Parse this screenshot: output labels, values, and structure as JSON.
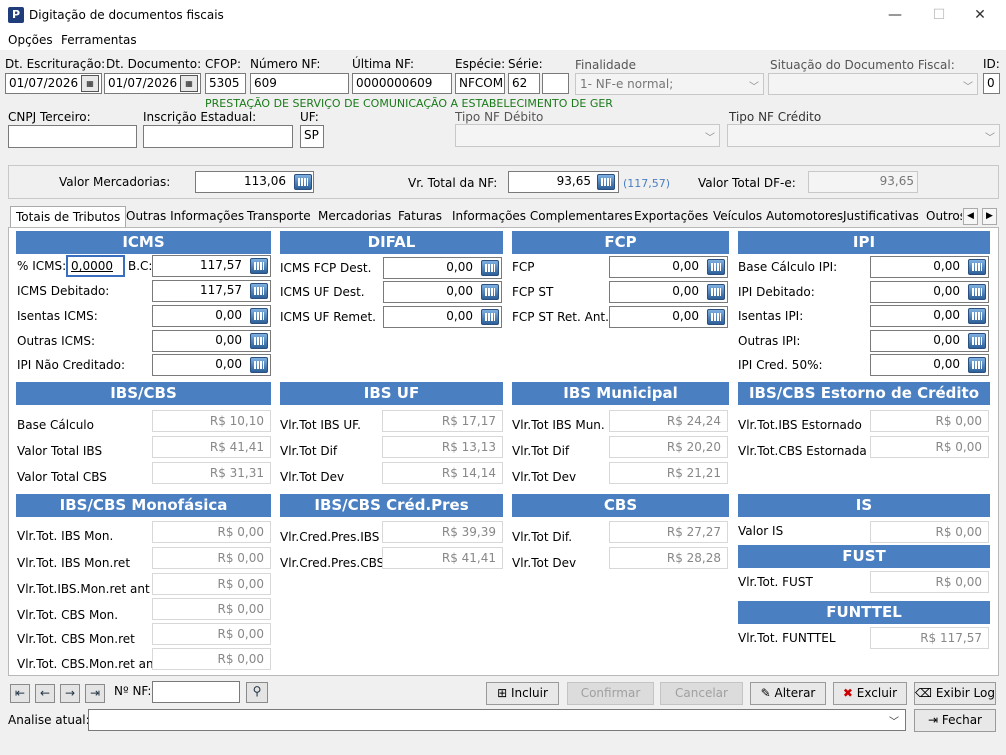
{
  "window": {
    "title": "Digitação de documentos fiscais",
    "minimize": "—",
    "maximize": "☐",
    "close": "✕"
  },
  "menu": [
    "Opções",
    "Ferramentas"
  ],
  "header": {
    "dt_escrituracao": {
      "label": "Dt. Escrituração:",
      "value": "01/07/2026"
    },
    "dt_documento": {
      "label": "Dt. Documento:",
      "value": "01/07/2026"
    },
    "cfop": {
      "label": "CFOP:",
      "value": "5305"
    },
    "numero_nf": {
      "label": "Número NF:",
      "value": "609"
    },
    "ultima_nf": {
      "label": "Última NF:",
      "value": "0000000609"
    },
    "especie": {
      "label": "Espécie:",
      "value": "NFCOM"
    },
    "serie": {
      "label": "Série:",
      "value": "62",
      "extra": ""
    },
    "finalidade": {
      "label": "Finalidade",
      "value": "1- NF-e normal;"
    },
    "situacao": {
      "label": "Situação do Documento Fiscal:",
      "value": ""
    },
    "id": {
      "label": "ID:",
      "value": "0"
    },
    "cfop_desc": "PRESTAÇÃO DE SERVIÇO DE COMUNICAÇÃO A ESTABELECIMENTO DE GER",
    "cnpj_terceiro": {
      "label": "CNPJ Terceiro:",
      "value": ""
    },
    "inscricao_estadual": {
      "label": "Inscrição Estadual:",
      "value": ""
    },
    "uf": {
      "label": "UF:",
      "value": "SP"
    },
    "tipo_nf_debito": {
      "label": "Tipo NF Débito",
      "value": ""
    },
    "tipo_nf_credito": {
      "label": "Tipo NF Crédito",
      "value": ""
    }
  },
  "totals": {
    "valor_mercadorias": {
      "label": "Valor Mercadorias:",
      "value": "113,06"
    },
    "vr_total_nf": {
      "label": "Vr. Total da NF:",
      "value": "93,65",
      "hint": "(117,57)"
    },
    "valor_total_dfe": {
      "label": "Valor Total DF-e:",
      "value": "93,65"
    }
  },
  "tabs": [
    "Totais de Tributos",
    "Outras Informações",
    "Transporte",
    "Mercadorias",
    "Faturas",
    "Informações Complementares",
    "Exportações",
    "Veículos Automotores",
    "Justificativas",
    "Outros"
  ],
  "sections": {
    "icms": {
      "title": "ICMS",
      "pct_label": "% ICMS:",
      "pct_value": "0,0000",
      "bc_label": "B.C:",
      "bc_value": "117,57",
      "rows": [
        {
          "label": "ICMS Debitado:",
          "value": "117,57"
        },
        {
          "label": "Isentas ICMS:",
          "value": "0,00"
        },
        {
          "label": "Outras ICMS:",
          "value": "0,00"
        },
        {
          "label": "IPI Não Creditado:",
          "value": "0,00"
        }
      ]
    },
    "difal": {
      "title": "DIFAL",
      "rows": [
        {
          "label": "ICMS FCP Dest.",
          "value": "0,00"
        },
        {
          "label": "ICMS UF Dest.",
          "value": "0,00"
        },
        {
          "label": "ICMS UF Remet.",
          "value": "0,00"
        }
      ]
    },
    "fcp": {
      "title": "FCP",
      "rows": [
        {
          "label": "FCP",
          "value": "0,00"
        },
        {
          "label": "FCP ST",
          "value": "0,00"
        },
        {
          "label": "FCP ST Ret. Ant.",
          "value": "0,00"
        }
      ]
    },
    "ipi": {
      "title": "IPI",
      "rows": [
        {
          "label": "Base Cálculo IPI:",
          "value": "0,00"
        },
        {
          "label": "IPI Debitado:",
          "value": "0,00"
        },
        {
          "label": "Isentas IPI:",
          "value": "0,00"
        },
        {
          "label": "Outras IPI:",
          "value": "0,00"
        },
        {
          "label": "IPI Cred. 50%:",
          "value": "0,00"
        }
      ]
    },
    "ibscbs": {
      "title": "IBS/CBS",
      "rows": [
        {
          "label": "Base Cálculo",
          "value": "R$ 10,10"
        },
        {
          "label": "Valor Total IBS",
          "value": "R$ 41,41"
        },
        {
          "label": "Valor Total CBS",
          "value": "R$ 31,31"
        }
      ]
    },
    "ibsuf": {
      "title": "IBS UF",
      "rows": [
        {
          "label": "Vlr.Tot IBS UF.",
          "value": "R$ 17,17"
        },
        {
          "label": "Vlr.Tot Dif",
          "value": "R$ 13,13"
        },
        {
          "label": "Vlr.Tot Dev",
          "value": "R$ 14,14"
        }
      ]
    },
    "ibsmun": {
      "title": "IBS Municipal",
      "rows": [
        {
          "label": "Vlr.Tot IBS Mun.",
          "value": "R$ 24,24"
        },
        {
          "label": "Vlr.Tot Dif",
          "value": "R$ 20,20"
        },
        {
          "label": "Vlr.Tot Dev",
          "value": "R$ 21,21"
        }
      ]
    },
    "estorno": {
      "title": "IBS/CBS Estorno de Crédito",
      "rows": [
        {
          "label": "Vlr.Tot.IBS Estornado",
          "value": "R$ 0,00"
        },
        {
          "label": "Vlr.Tot.CBS Estornada",
          "value": "R$ 0,00"
        }
      ]
    },
    "mono": {
      "title": "IBS/CBS Monofásica",
      "rows": [
        {
          "label": "Vlr.Tot. IBS Mon.",
          "value": "R$ 0,00"
        },
        {
          "label": "Vlr.Tot. IBS Mon.ret",
          "value": "R$ 0,00"
        },
        {
          "label": "Vlr.Tot.IBS.Mon.ret ant",
          "value": "R$ 0,00"
        },
        {
          "label": "Vlr.Tot. CBS Mon.",
          "value": "R$ 0,00"
        },
        {
          "label": "Vlr.Tot. CBS Mon.ret",
          "value": "R$ 0,00"
        },
        {
          "label": "Vlr.Tot. CBS.Mon.ret ant",
          "value": "R$ 0,00"
        }
      ]
    },
    "credpres": {
      "title": "IBS/CBS Créd.Pres",
      "rows": [
        {
          "label": "Vlr.Cred.Pres.IBS",
          "value": "R$ 39,39"
        },
        {
          "label": "Vlr.Cred.Pres.CBS",
          "value": "R$ 41,41"
        }
      ]
    },
    "cbs": {
      "title": "CBS",
      "rows": [
        {
          "label": "Vlr.Tot Dif.",
          "value": "R$ 27,27"
        },
        {
          "label": "Vlr.Tot Dev",
          "value": "R$ 28,28"
        }
      ]
    },
    "is": {
      "title": "IS",
      "rows": [
        {
          "label": "Valor IS",
          "value": "R$ 0,00"
        }
      ]
    },
    "fust": {
      "title": "FUST",
      "rows": [
        {
          "label": "Vlr.Tot. FUST",
          "value": "R$ 0,00"
        }
      ]
    },
    "funttel": {
      "title": "FUNTTEL",
      "rows": [
        {
          "label": "Vlr.Tot. FUNTTEL",
          "value": "R$ 117,57"
        }
      ]
    }
  },
  "footer": {
    "nf_label": "Nº NF:",
    "nf_value": "",
    "incluir": "Incluir",
    "confirmar": "Confirmar",
    "cancelar": "Cancelar",
    "alterar": "Alterar",
    "excluir": "Excluir",
    "exibir_log": "Exibir Log",
    "fechar": "Fechar",
    "analise_label": "Analise atual:",
    "analise_value": ""
  }
}
